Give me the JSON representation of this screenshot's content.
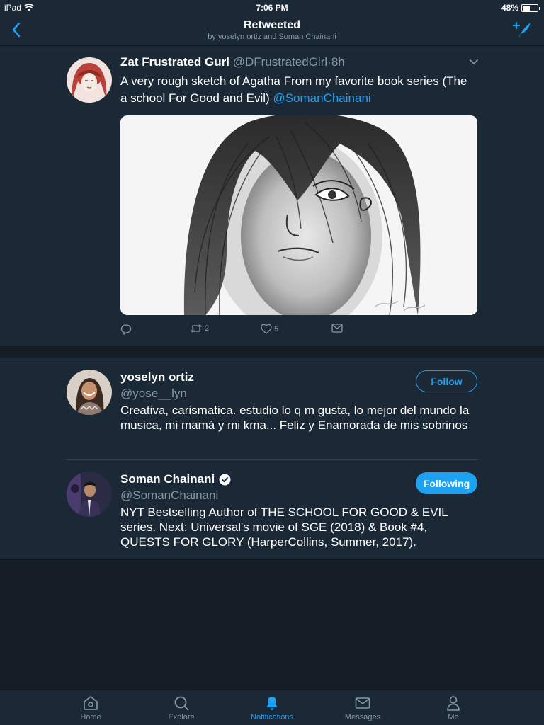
{
  "status_bar": {
    "device": "iPad",
    "time": "7:06 PM",
    "battery": "48%",
    "battery_level": 0.48
  },
  "nav": {
    "title": "Retweeted",
    "subtitle": "by yoselyn ortiz and Soman Chainani"
  },
  "tweet": {
    "name": "Zat Frustrated Gurl",
    "handle": "@DFrustratedGirl",
    "separator": "·",
    "time": "8h",
    "text": "A very rough sketch of Agatha From my favorite book series (The a school For Good and Evil) ",
    "mention": "@SomanChainani",
    "retweet_count": "2",
    "like_count": "5",
    "reply_count": "",
    "icons": [
      "reply-icon",
      "retweet-icon",
      "like-icon",
      "direct-message-icon"
    ]
  },
  "users": [
    {
      "name": "yoselyn ortiz",
      "handle": "@yose__lyn",
      "bio": "Creativa, carismatica. estudio lo q m gusta, lo mejor del mundo la musica, mi mamá y mi kma... Feliz y Enamorada de mis sobrinos",
      "button": "Follow",
      "verified": false
    },
    {
      "name": "Soman Chainani",
      "handle": "@SomanChainani",
      "bio": "NYT Bestselling Author of THE SCHOOL FOR GOOD & EVIL series. Next: Universal's movie of SGE (2018) & Book #4, QUESTS FOR GLORY (HarperCollins, Summer, 2017).",
      "button": "Following",
      "verified": true
    }
  ],
  "tabs": [
    {
      "label": "Home",
      "icon": "home-icon",
      "active": false
    },
    {
      "label": "Explore",
      "icon": "search-icon",
      "active": false
    },
    {
      "label": "Notifications",
      "icon": "bell-icon",
      "active": true
    },
    {
      "label": "Messages",
      "icon": "envelope-icon",
      "active": false
    },
    {
      "label": "Me",
      "icon": "person-icon",
      "active": false
    }
  ],
  "colors": {
    "accent": "#1da1f2",
    "background": "#141d26",
    "panel": "#1b2836",
    "muted": "#8899a6"
  }
}
